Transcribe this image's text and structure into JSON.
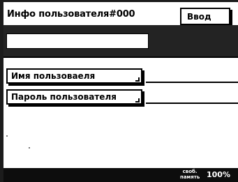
{
  "header": {
    "title": "Инфо пользователя#000",
    "enter_label": "Ввод"
  },
  "input": {
    "value": ""
  },
  "fields": [
    {
      "label": "Имя пользоваеля"
    },
    {
      "label": "Пароль пользователя"
    }
  ],
  "footer": {
    "memory_label_line1": "своб.",
    "memory_label_line2": "память",
    "memory_value": "100%"
  }
}
